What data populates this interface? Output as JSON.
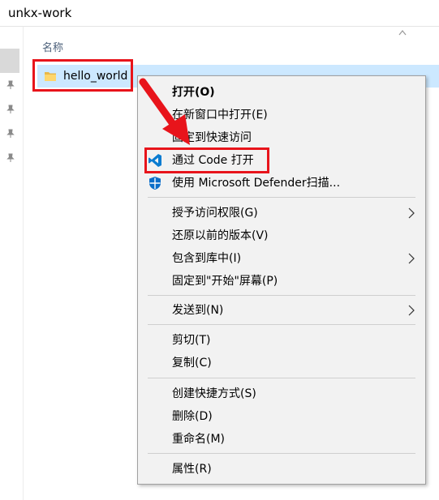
{
  "window": {
    "title": "unkx-work"
  },
  "list": {
    "column_name": "名称",
    "files": [
      {
        "name": "hello_world"
      }
    ]
  },
  "context_menu": {
    "items": [
      {
        "label": "打开(O)",
        "bold": true
      },
      {
        "label": "在新窗口中打开(E)"
      },
      {
        "label": "固定到快速访问"
      },
      {
        "label": "通过 Code 打开",
        "icon": "vscode-icon"
      },
      {
        "label": "使用 Microsoft Defender扫描...",
        "icon": "defender-shield-icon"
      },
      {
        "label": "授予访问权限(G)",
        "submenu": true
      },
      {
        "label": "还原以前的版本(V)"
      },
      {
        "label": "包含到库中(I)",
        "submenu": true
      },
      {
        "label": "固定到\"开始\"屏幕(P)"
      },
      {
        "label": "发送到(N)",
        "submenu": true
      },
      {
        "label": "剪切(T)"
      },
      {
        "label": "复制(C)"
      },
      {
        "label": "创建快捷方式(S)"
      },
      {
        "label": "删除(D)"
      },
      {
        "label": "重命名(M)"
      },
      {
        "label": "属性(R)"
      }
    ]
  },
  "colors": {
    "selection": "#cce8ff",
    "highlight_border": "#e8141b",
    "menu_bg": "#f2f2f2",
    "vscode_blue": "#0a7cd1",
    "defender_blue": "#0b6ec9"
  }
}
